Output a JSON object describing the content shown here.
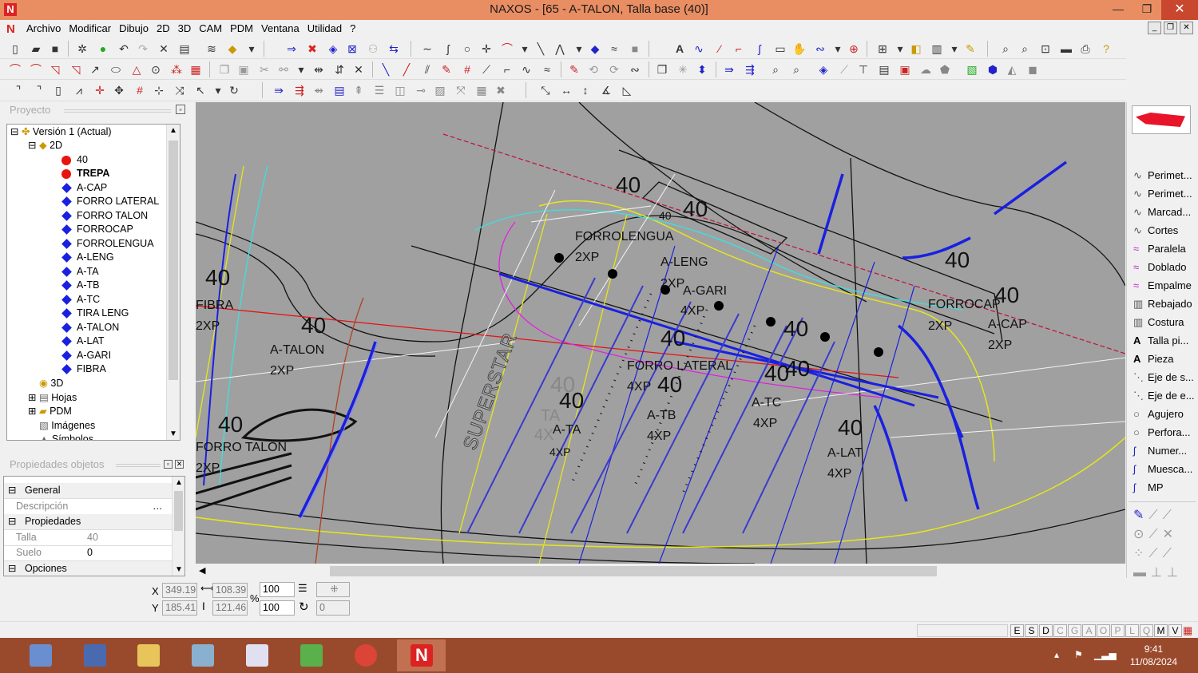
{
  "window": {
    "title": "NAXOS - [65 - A-TALON, Talla base (40)]",
    "logo": "N",
    "min": "—",
    "max": "❐",
    "close": "✕"
  },
  "menu": {
    "items": [
      "Archivo",
      "Modificar",
      "Dibujo",
      "2D",
      "3D",
      "CAM",
      "PDM",
      "Ventana",
      "Utilidad",
      "?"
    ]
  },
  "mdi": {
    "min": "_",
    "restore": "❐",
    "close": "✕"
  },
  "project_panel": {
    "header": "Proyecto",
    "root": "Versión 1 (Actual)",
    "node_2d": "2D",
    "sizes": [
      "40",
      "TREPA"
    ],
    "pieces": [
      "A-CAP",
      "FORRO LATERAL",
      "FORRO TALON",
      "FORROCAP",
      "FORROLENGUA",
      "A-LENG",
      "A-TA",
      "A-TB",
      "A-TC",
      "TIRA LENG",
      "A-TALON",
      "A-LAT",
      "A-GARI",
      "FIBRA"
    ],
    "nodes": [
      "3D",
      "Hojas",
      "PDM",
      "Imágenes",
      "Símbolos"
    ]
  },
  "props_panel": {
    "header": "Propiedades objetos",
    "general": "General",
    "descripcion_label": "Descripción",
    "propiedades": "Propiedades",
    "talla_label": "Talla",
    "talla_value": "40",
    "suelo_label": "Suelo",
    "suelo_value": "0",
    "opciones": "Opciones"
  },
  "canvas_labels": [
    {
      "t": "40",
      "cls": "big"
    },
    {
      "t": "40",
      "cls": "big"
    },
    {
      "t": "40",
      "cls": "sm"
    },
    {
      "t": "FORROLENGUA",
      "cls": "md"
    },
    {
      "t": "2XP",
      "cls": "md"
    },
    {
      "t": "A-LENG",
      "cls": "md"
    },
    {
      "t": "2XP",
      "cls": "md"
    },
    {
      "t": "A-GARI",
      "cls": "md"
    },
    {
      "t": "4XP",
      "cls": "md"
    },
    {
      "t": "40",
      "cls": "big"
    },
    {
      "t": "FIBRA",
      "cls": "md"
    },
    {
      "t": "2XP",
      "cls": "md"
    },
    {
      "t": "40",
      "cls": "big"
    },
    {
      "t": "A-TALON",
      "cls": "md"
    },
    {
      "t": "2XP",
      "cls": "md"
    },
    {
      "t": "40",
      "cls": "big"
    },
    {
      "t": "40",
      "cls": "big"
    },
    {
      "t": "FORRO LATERAL",
      "cls": "md"
    },
    {
      "t": "4XP",
      "cls": "md"
    },
    {
      "t": "40",
      "cls": "big"
    },
    {
      "t": "40",
      "cls": "big"
    },
    {
      "t": "40",
      "cls": "big"
    },
    {
      "t": "A-TA",
      "cls": "md"
    },
    {
      "t": "4XP",
      "cls": "sm"
    },
    {
      "t": "A-TB",
      "cls": "md"
    },
    {
      "t": "4XP",
      "cls": "md"
    },
    {
      "t": "40",
      "cls": "big"
    },
    {
      "t": "A-TC",
      "cls": "md"
    },
    {
      "t": "4XP",
      "cls": "md"
    },
    {
      "t": "40",
      "cls": "big"
    },
    {
      "t": "FORROCAP",
      "cls": "md"
    },
    {
      "t": "2XP",
      "cls": "md"
    },
    {
      "t": "40",
      "cls": "big"
    },
    {
      "t": "A-CAP",
      "cls": "md"
    },
    {
      "t": "2XP",
      "cls": "md"
    },
    {
      "t": "40",
      "cls": "big"
    },
    {
      "t": "A-LAT",
      "cls": "md"
    },
    {
      "t": "4XP",
      "cls": "md"
    },
    {
      "t": "40",
      "cls": "big"
    },
    {
      "t": "FORRO TALON",
      "cls": "md"
    },
    {
      "t": "2XP",
      "cls": "md"
    },
    {
      "t": "SUPERSTAR",
      "cls": "rot"
    },
    {
      "t": "40",
      "cls": "big"
    },
    {
      "t": "TA",
      "cls": "md"
    },
    {
      "t": "4X",
      "cls": "md"
    }
  ],
  "right_panel": {
    "items": [
      "Perimet...",
      "Perimet...",
      "Marcad...",
      "Cortes",
      "Paralela",
      "Doblado",
      "Empalme",
      "Rebajado",
      "Costura",
      "Talla pi...",
      "Pieza",
      "Eje de s...",
      "Eje de e...",
      "Agujero",
      "Perfora...",
      "Numer...",
      "Muesca...",
      "MP"
    ],
    "icons": [
      "wave-icon",
      "wave-icon",
      "wave-icon",
      "wave-icon",
      "wave-icon",
      "wave-icon",
      "wave-icon",
      "book-icon",
      "book-icon",
      "letter-a-icon",
      "letter-a-icon",
      "dash-icon",
      "dash-icon",
      "circle-icon",
      "circle-icon",
      "pen-icon",
      "pen-icon",
      "pen-icon"
    ]
  },
  "coords": {
    "x_label": "X",
    "x_value": "349.19",
    "y_label": "Y",
    "y_value": "185.41",
    "w_value": "108.39",
    "h_value": "121.46",
    "scale_x": "100",
    "scale_y": "100",
    "pct": "%",
    "rot_value": "0"
  },
  "status": {
    "flags": [
      "E",
      "S",
      "D",
      "C",
      "G",
      "A",
      "O",
      "P",
      "L",
      "Q",
      "M",
      "V"
    ],
    "active": [
      "E",
      "S",
      "D",
      "M",
      "V"
    ]
  },
  "taskbar": {
    "time": "9:41",
    "date": "11/08/2024"
  },
  "colors": {
    "titlebar": "#e98e63",
    "canvas": "#a0a0a0",
    "taskbar": "#9a4a2c",
    "red_dot": "#e8140e",
    "blue_diamond": "#1a20e0"
  }
}
